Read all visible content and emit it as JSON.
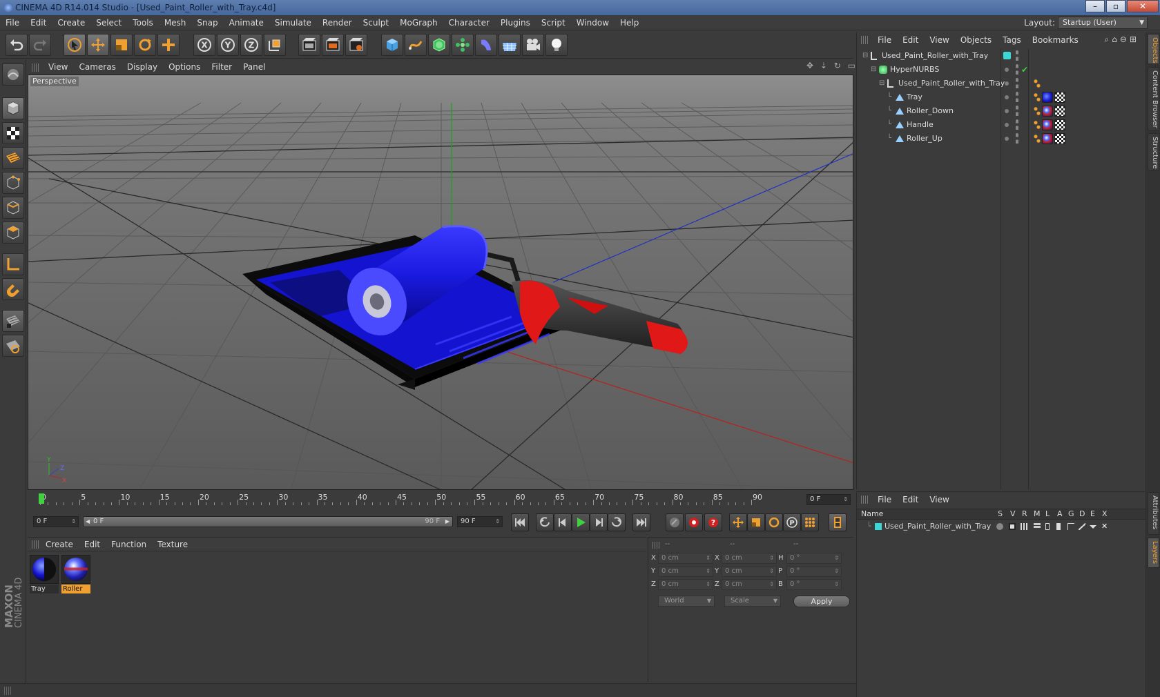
{
  "window": {
    "title": "CINEMA 4D R14.014 Studio - [Used_Paint_Roller_with_Tray.c4d]",
    "controls": [
      "–",
      "▫",
      "✕"
    ]
  },
  "menubar": {
    "items": [
      "File",
      "Edit",
      "Create",
      "Select",
      "Tools",
      "Mesh",
      "Snap",
      "Animate",
      "Simulate",
      "Render",
      "Sculpt",
      "MoGraph",
      "Character",
      "Plugins",
      "Script",
      "Window",
      "Help"
    ],
    "layout_label": "Layout:",
    "layout_value": "Startup (User)"
  },
  "viewport": {
    "menu": [
      "View",
      "Cameras",
      "Display",
      "Options",
      "Filter",
      "Panel"
    ],
    "camera_label": "Perspective",
    "nav_icons": "✥ ⇣ ↻ ▭",
    "axis_labels": {
      "y": "Y",
      "z": "Z",
      "x": "X"
    }
  },
  "object_manager": {
    "menu": [
      "File",
      "Edit",
      "View",
      "Objects",
      "Tags",
      "Bookmarks"
    ],
    "objects": [
      {
        "name": "Used_Paint_Roller_with_Tray",
        "depth": 0,
        "icon": "null-icon",
        "layer_color": "#3cd6d6"
      },
      {
        "name": "HyperNURBS",
        "depth": 1,
        "icon": "hypernurbs-icon"
      },
      {
        "name": "Used_Paint_Roller_with_Tray",
        "depth": 2,
        "icon": "null-icon"
      },
      {
        "name": "Tray",
        "depth": 3,
        "icon": "polygon-object-icon",
        "material": "Tray"
      },
      {
        "name": "Roller_Down",
        "depth": 3,
        "icon": "polygon-object-icon",
        "material": "Roller"
      },
      {
        "name": "Handle",
        "depth": 3,
        "icon": "polygon-object-icon",
        "material": "Roller"
      },
      {
        "name": "Roller_Up",
        "depth": 3,
        "icon": "polygon-object-icon",
        "material": "Roller"
      }
    ],
    "check_mark": "✔"
  },
  "right_tabs": [
    "Objects",
    "Content Browser",
    "Structure"
  ],
  "right_tabs_lower": [
    "Attributes",
    "Layers"
  ],
  "timeline": {
    "labels": [
      "0",
      "5",
      "10",
      "15",
      "20",
      "25",
      "30",
      "35",
      "40",
      "45",
      "50",
      "55",
      "60",
      "65",
      "70",
      "75",
      "80",
      "85",
      "90"
    ],
    "current_frame": 0,
    "end_frame_field": "0 F"
  },
  "transport": {
    "start_field": "0 F",
    "range_start": "0 F",
    "range_end": "90 F",
    "end_field": "90 F"
  },
  "material_manager": {
    "menu": [
      "Create",
      "Edit",
      "Function",
      "Texture"
    ],
    "materials": [
      {
        "name": "Tray",
        "selected": false
      },
      {
        "name": "Roller",
        "selected": true
      }
    ]
  },
  "coordinates": {
    "headers": [
      "--",
      "--",
      "--"
    ],
    "rows": [
      {
        "a": "X",
        "av": "0 cm",
        "b": "X",
        "bv": "0 cm",
        "c": "H",
        "cv": "0 °"
      },
      {
        "a": "Y",
        "av": "0 cm",
        "b": "Y",
        "bv": "0 cm",
        "c": "P",
        "cv": "0 °"
      },
      {
        "a": "Z",
        "av": "0 cm",
        "b": "Z",
        "bv": "0 cm",
        "c": "B",
        "cv": "0 °"
      }
    ],
    "mode_world": "World",
    "mode_scale": "Scale",
    "apply": "Apply"
  },
  "layer_manager": {
    "menu": [
      "File",
      "Edit",
      "View"
    ],
    "columns": [
      "Name",
      "S",
      "V",
      "R",
      "M",
      "L",
      "A",
      "G",
      "D",
      "E",
      "X"
    ],
    "layers": [
      {
        "name": "Used_Paint_Roller_with_Tray",
        "color": "#3cd6d6"
      }
    ]
  },
  "logo": {
    "maxon": "MAXON",
    "product": "CINEMA 4D"
  },
  "colors": {
    "accent": "#f0a030",
    "selection_green": "#40d040",
    "object_blue": "#1a1ae6",
    "handle_red": "#e01818"
  }
}
